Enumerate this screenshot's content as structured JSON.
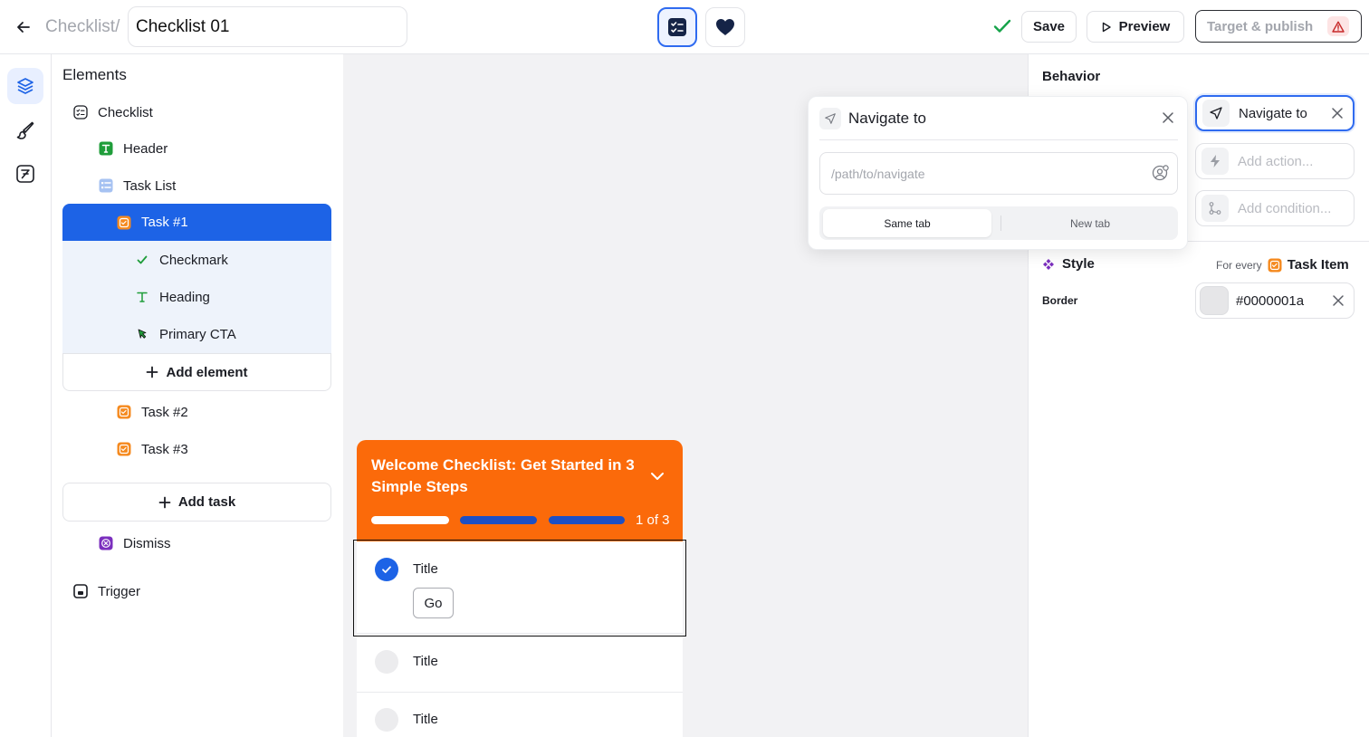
{
  "topbar": {
    "breadcrumb": "Checklist/",
    "name_value": "Checklist 01",
    "save_label": "Save",
    "preview_label": "Preview",
    "target_label": "Target & publish"
  },
  "elements_panel": {
    "title": "Elements",
    "items": {
      "checklist": "Checklist",
      "header": "Header",
      "task_list": "Task List",
      "task1": "Task #1",
      "checkmark": "Checkmark",
      "heading": "Heading",
      "primary_cta": "Primary CTA",
      "add_element": "Add element",
      "task2": "Task #2",
      "task3": "Task #3",
      "add_task": "Add task",
      "dismiss": "Dismiss",
      "trigger": "Trigger"
    }
  },
  "widget": {
    "title": "Welcome Checklist: Get Started in 3 Simple Steps",
    "progress_text": "1 of 3",
    "progress_completed": 1,
    "progress_total": 3,
    "tasks": [
      {
        "title": "Title",
        "completed": true,
        "cta": "Go"
      },
      {
        "title": "Title",
        "completed": false
      },
      {
        "title": "Title",
        "completed": false
      }
    ]
  },
  "behavior": {
    "title": "Behavior",
    "navigate_chip": "Navigate to",
    "add_action": "Add action...",
    "add_condition": "Add condition..."
  },
  "style": {
    "title": "Style",
    "for_every": "For every",
    "target": "Task Item",
    "border_label": "Border",
    "border_value": "#0000001a"
  },
  "popover": {
    "title": "Navigate to",
    "placeholder": "/path/to/navigate",
    "same_tab": "Same tab",
    "new_tab": "New tab"
  },
  "colors": {
    "accent": "#1d63e6",
    "widget_header": "#fb6a0a",
    "progress_done": "#ffffff",
    "progress_todo": "#1d4fc4",
    "success": "#16a34a"
  }
}
